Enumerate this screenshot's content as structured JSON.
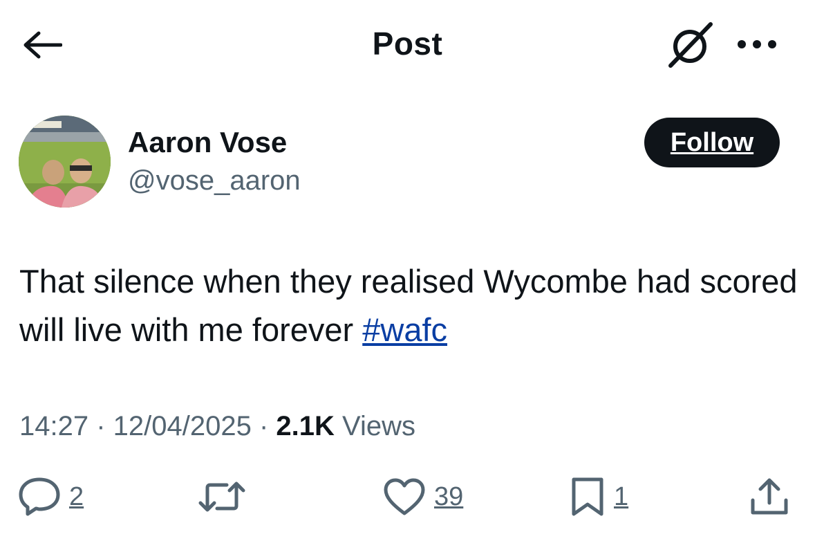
{
  "header": {
    "title": "Post",
    "back_icon": "arrow-left-icon",
    "grok_icon": "grok-icon",
    "more_icon": "more-horizontal-icon"
  },
  "author": {
    "name": "Aaron Vose",
    "handle": "@vose_aaron",
    "follow_label": "Follow"
  },
  "post": {
    "text": "That silence when they realised Wycombe had scored will live with me forever ",
    "hashtag": "#wafc",
    "time": "14:27",
    "separator": " · ",
    "date": "12/04/2025",
    "views_count": "2.1K",
    "views_label": " Views"
  },
  "actions": {
    "reply_count": "2",
    "like_count": "39",
    "bookmark_count": "1"
  },
  "colors": {
    "text": "#0f1419",
    "secondary": "#536471",
    "link": "#0a3ea3",
    "follow_bg": "#0f1419"
  }
}
